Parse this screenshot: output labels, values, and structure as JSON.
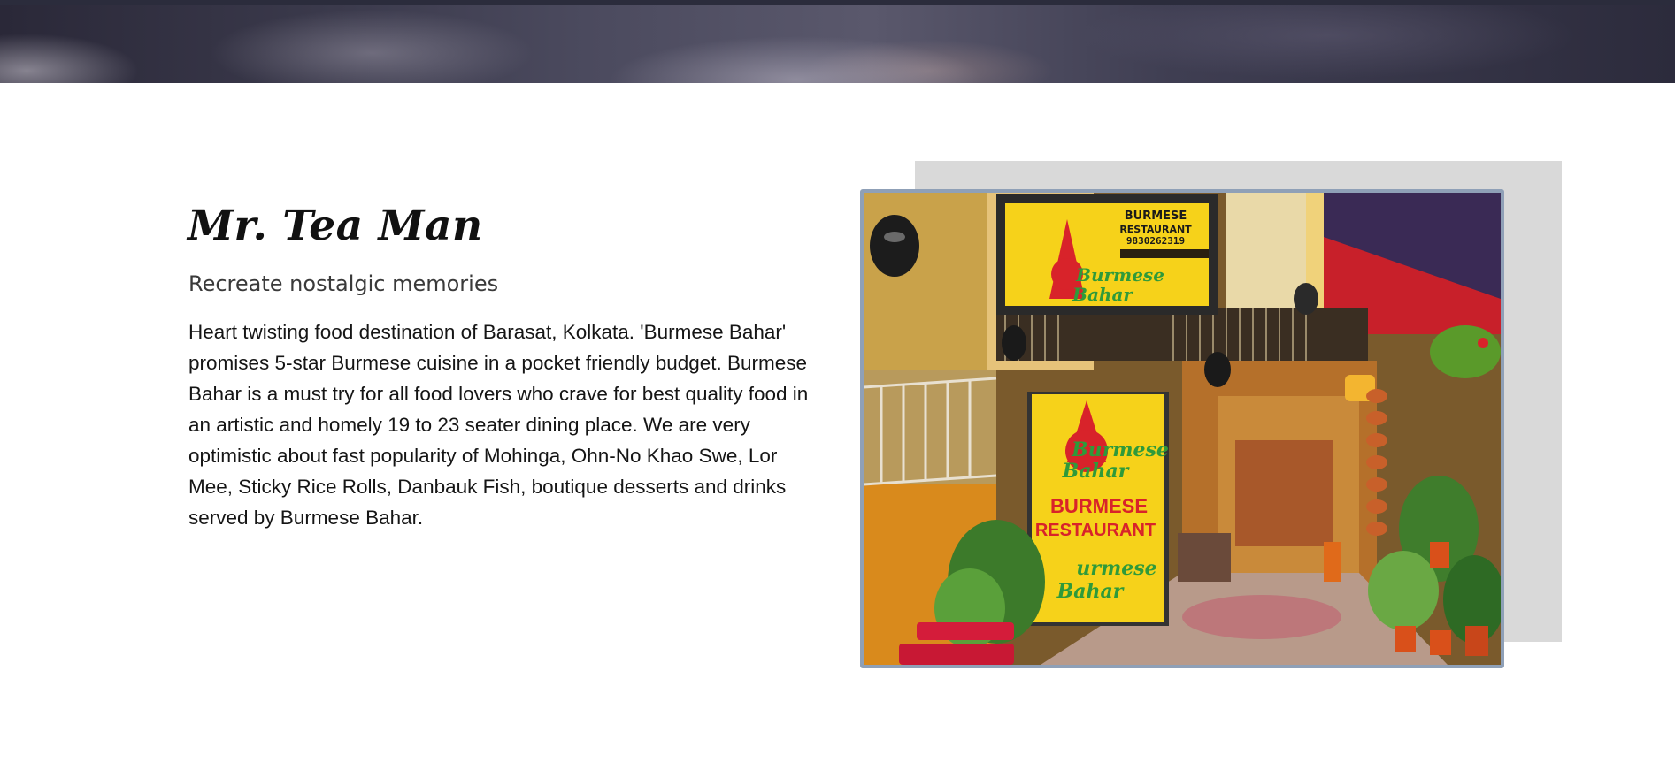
{
  "about": {
    "title": "Mr. Tea Man",
    "subtitle": "Recreate nostalgic memories",
    "body": "Heart twisting food destination of Barasat, Kolkata. 'Burmese Bahar' promises 5-star Burmese cuisine in a pocket friendly budget. Burmese Bahar is a must try for all food lovers who crave for best quality food in an artistic and homely 19 to 23 seater dining place. We are very optimistic about fast popularity of Mohinga, Ohn-No Khao Swe, Lor Mee, Sticky Rice Rolls, Danbauk Fish, boutique desserts and drinks served by Burmese Bahar."
  },
  "photo": {
    "sign_top": {
      "line1": "BURMESE",
      "line2": "RESTAURANT",
      "phone": "9830262319",
      "logo_line1": "Burmese",
      "logo_line2": "Bahar"
    },
    "sign_main": {
      "logo_line1": "Burmese",
      "logo_line2": "Bahar",
      "line1": "BURMESE",
      "line2": "RESTAURANT",
      "logo_bottom_line1": "urmese",
      "logo_bottom_line2": "Bahar"
    }
  },
  "colors": {
    "sign_yellow": "#f6d21a",
    "sign_red": "#d8232a",
    "sign_green": "#2f9a3a",
    "frame_border": "#8fa0b7",
    "shadow_panel": "#d9d9d9"
  }
}
